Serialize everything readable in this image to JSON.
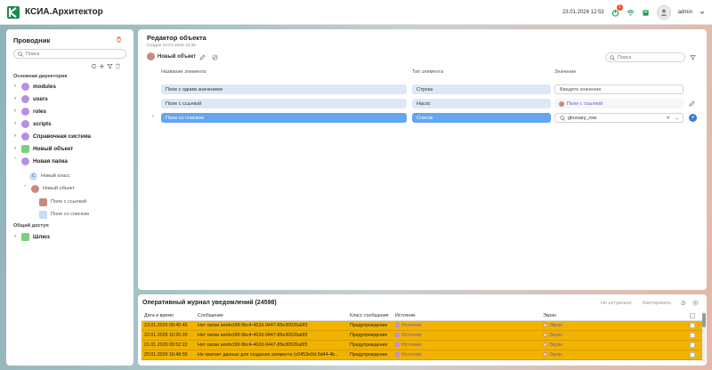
{
  "app": {
    "title": "КСИА.Архитектор"
  },
  "header": {
    "datetime": "23.01.2026 12:53",
    "notifications_count": "1",
    "username": "admin",
    "colors": {
      "accent": "#1f9d55",
      "badge": "#e94f37"
    }
  },
  "explorer": {
    "title": "Проводник",
    "search_placeholder": "Поиск",
    "section_main": "Основная директория",
    "section_shared": "Общий доступ",
    "items": [
      {
        "label": "modules",
        "icon": "purple-node-icon"
      },
      {
        "label": "users",
        "icon": "purple-node-icon"
      },
      {
        "label": "roles",
        "icon": "purple-node-icon"
      },
      {
        "label": "scripts",
        "icon": "purple-node-icon"
      },
      {
        "label": "Справочная система",
        "icon": "purple-node-icon"
      },
      {
        "label": "Новый объект",
        "icon": "green-object-icon"
      },
      {
        "label": "Новая папка",
        "icon": "purple-node-icon",
        "expanded": true
      },
      {
        "label": "Новый класс",
        "icon": "class-icon"
      },
      {
        "label": "Новый объект",
        "icon": "object-icon",
        "expanded": true
      },
      {
        "label": "Поле с ссылкой",
        "icon": "link-field-icon"
      },
      {
        "label": "Поле со списком",
        "icon": "list-field-icon"
      }
    ],
    "shared_items": [
      {
        "label": "Шлюз",
        "icon": "gateway-icon"
      }
    ]
  },
  "editor": {
    "title": "Редактор объекта",
    "created": "Создан 23.01.2026 12:38",
    "object_name": "Новый объект",
    "search_placeholder": "Поиск",
    "columns": {
      "name": "Название элемента",
      "type": "Тип элемента",
      "value": "Значение"
    },
    "rows": [
      {
        "name": "Поле с одним значением",
        "type": "Строка",
        "value": "Введите значение"
      },
      {
        "name": "Поле с ссылкой",
        "type": "Насос",
        "value": "Поле с ссылкой"
      },
      {
        "name": "Поле со списком",
        "type": "Список",
        "value": "glossary_row"
      }
    ]
  },
  "journal": {
    "title": "Оперативный журнал уведомлений (24598)",
    "btn_not_actual": "Не актуально",
    "btn_ack": "Квитировать",
    "columns": {
      "datetime": "Дата и время",
      "message": "Сообщение",
      "msg_class": "Класс сообщения",
      "source": "Источник",
      "screen": "Экран"
    },
    "rows": [
      {
        "datetime": "23.01.2026 09:45:46",
        "message": "Нет связи aeebc06f-9bc4-462d-9447-85e30026a0f3",
        "msg_class": "Предупреждение",
        "source": "Источник",
        "screen": "Экран"
      },
      {
        "datetime": "22.01.2026 10:20:20",
        "message": "Нет связи aeebc06f-9bc4-462d-9447-85e30026a0f3",
        "msg_class": "Предупреждение",
        "source": "Источник",
        "screen": "Экран"
      },
      {
        "datetime": "21.01.2026 09:52:22",
        "message": "Нет связи aeebc06f-9bc4-462d-9447-85e30026a0f3",
        "msg_class": "Предупреждение",
        "source": "Источник",
        "screen": "Экран"
      },
      {
        "datetime": "20.01.2026 16:48:55",
        "message": "Не хватает данных для создания элемента (c0453e0d-3d44-4b...",
        "msg_class": "Предупреждение",
        "source": "Источник",
        "screen": "Экран"
      }
    ],
    "row_color": "#f1b300"
  }
}
